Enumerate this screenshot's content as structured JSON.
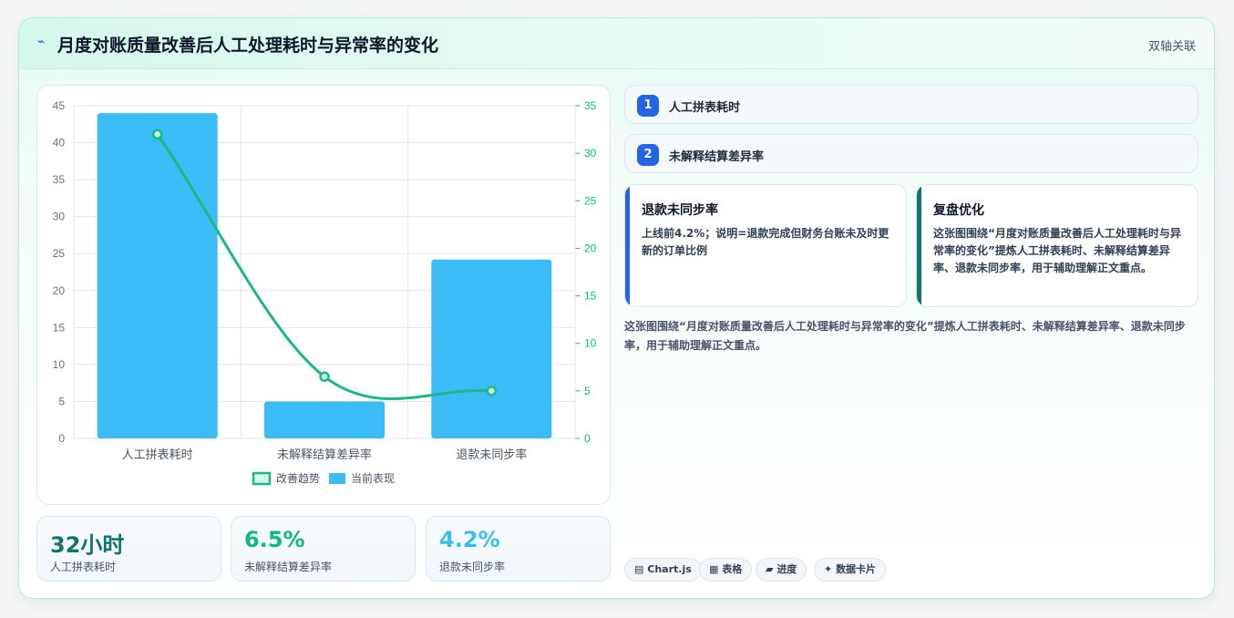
{
  "header": {
    "icon": "lightning-icon",
    "title": "月度对账质量改善后人工处理耗时与异常率的变化",
    "right": "双轴关联"
  },
  "chart_data": {
    "type": "bar",
    "categories": [
      "人工拼表耗时",
      "未解释结算差异率",
      "退款未同步率"
    ],
    "series": [
      {
        "name": "当前表现",
        "type": "bar",
        "axis": "left",
        "color": "#3bbcf7",
        "values": [
          44,
          5,
          24.2
        ]
      },
      {
        "name": "改善趋势",
        "type": "line",
        "axis": "right",
        "color": "#1db981",
        "values": [
          32,
          6.5,
          5
        ]
      }
    ],
    "ylim_left": [
      0,
      45
    ],
    "ylim_right": [
      0,
      35
    ],
    "yticks_left": [
      0,
      5,
      10,
      15,
      20,
      25,
      30,
      35,
      40,
      45
    ],
    "yticks_right": [
      0,
      5,
      10,
      15,
      20,
      25,
      30,
      35
    ],
    "legend": {
      "position": "bottom",
      "items": [
        "改善趋势",
        "当前表现"
      ]
    },
    "grid": true
  },
  "stats": [
    {
      "value": "32小时",
      "label": "人工拼表耗时",
      "color": "#0f766e"
    },
    {
      "value": "6.5%",
      "label": "未解释结算差异率",
      "color": "#10b981"
    },
    {
      "value": "4.2%",
      "label": "退款未同步率",
      "color": "#38bdf8"
    }
  ],
  "items": [
    {
      "num": "1",
      "label": "人工拼表耗时"
    },
    {
      "num": "2",
      "label": "未解释结算差异率"
    }
  ],
  "notes": [
    {
      "title": "退款未同步率",
      "body": "上线前4.2%；说明=退款完成但财务台账未及时更新的订单比例",
      "accent": "#2563eb"
    },
    {
      "title": "复盘优化",
      "body": "这张图围绕“月度对账质量改善后人工处理耗时与异常率的变化”提炼人工拼表耗时、未解释结算差异率、退款未同步率，用于辅助理解正文重点。",
      "accent": "#0f766e"
    }
  ],
  "summary": "这张图围绕“月度对账质量改善后人工处理耗时与异常率的变化”提炼人工拼表耗时、未解释结算差异率、退款未同步率，用于辅助理解正文重点。",
  "tags": [
    {
      "icon": "▤",
      "label": "Chart.js"
    },
    {
      "icon": "▦",
      "label": "表格"
    },
    {
      "icon": "▰",
      "label": "进度"
    },
    {
      "icon": "✦",
      "label": "数据卡片"
    }
  ]
}
